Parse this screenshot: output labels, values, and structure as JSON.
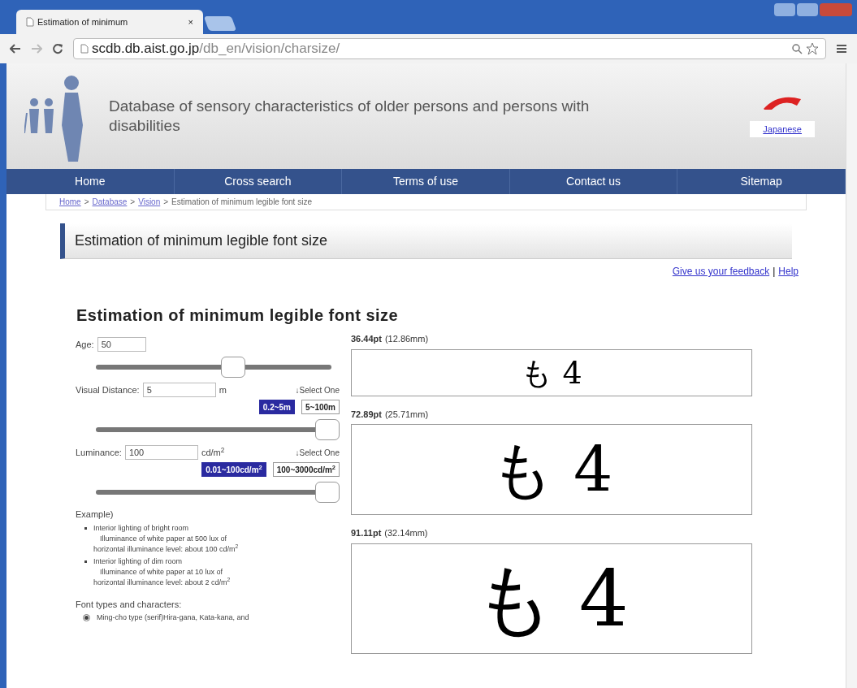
{
  "browser": {
    "tab_title": "Estimation of minimum",
    "close": "×",
    "url_host": "scdb.db.aist.go.jp",
    "url_path": "/db_en/vision/charsize/"
  },
  "header": {
    "title": "Database of sensory characteristics of older persons and persons with disabilities",
    "language_link": "Japanese"
  },
  "nav": [
    "Home",
    "Cross search",
    "Terms of use",
    "Contact us",
    "Sitemap"
  ],
  "breadcrumb": [
    {
      "text": "Home",
      "kind": "link"
    },
    {
      "text": ">",
      "kind": "text"
    },
    {
      "text": "Database",
      "kind": "link"
    },
    {
      "text": ">",
      "kind": "text"
    },
    {
      "text": "Vision",
      "kind": "link"
    },
    {
      "text": ">",
      "kind": "text"
    },
    {
      "text": "Estimation of minimum legible font size",
      "kind": "text"
    }
  ],
  "page_title": "Estimation of minimum legible font size",
  "links": [
    {
      "text": "Give us your feedback"
    },
    {
      "text": "|"
    },
    {
      "text": "Help"
    }
  ],
  "heading": "Estimation of minimum legible font size",
  "controls": [
    {
      "label": "Age:",
      "value": "50",
      "level": 0.57
    },
    {
      "label": "Visual Distance:",
      "value": "5",
      "unit": "m",
      "select_label": "↓Select One",
      "options": [
        {
          "text": "0.2~5m",
          "selected": true
        },
        {
          "text": "5~100m",
          "selected": false
        }
      ],
      "level": 1
    },
    {
      "label": "Luminance:",
      "value": "100",
      "unit": "cd/m$^{2}$",
      "select_label": "↓Select One",
      "options": [
        {
          "text": "0.01~100cd/m$^{2}$",
          "selected": true
        },
        {
          "text": "100~3000cd/m$^{2}$",
          "selected": false
        }
      ],
      "level": 1
    }
  ],
  "example": {
    "title": "Example)",
    "items": [
      {
        "title": "Interior lighting of bright room",
        "line1": "Illuminance of white paper at 500 lux of",
        "line2": "horizontal illuminance level: about 100 cd/m$^{2}$"
      },
      {
        "title": "Interior lighting of dim room",
        "line1": "Illuminance of white paper at 10 lux of",
        "line2": "horizontal illuminance level: about 2 cd/m$^{2}$"
      }
    ]
  },
  "font_types": {
    "title": "Font types and characters:",
    "options": [
      {
        "text": "Ming-cho type (serif)Hira-gana, Kata-kana, and",
        "selected": true
      }
    ]
  },
  "samples": [
    {
      "pt": "36.44pt",
      "mm": "(12.86mm)",
      "chars": "も 4"
    },
    {
      "pt": "72.89pt",
      "mm": "(25.71mm)",
      "chars": "も 4"
    },
    {
      "pt": "91.11pt",
      "mm": "(32.14mm)",
      "chars": "も 4"
    }
  ]
}
